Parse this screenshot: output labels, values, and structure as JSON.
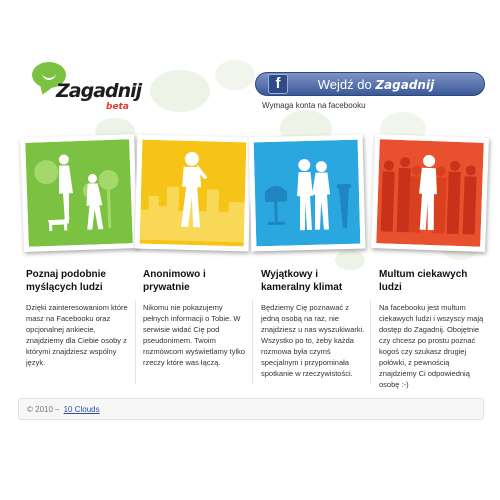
{
  "header": {
    "logo_text": "Zagadnij",
    "logo_badge": "beta",
    "facebook_button": {
      "icon": "facebook-f-icon",
      "label": "Wejdź do",
      "brand": "Zagadnij"
    },
    "facebook_note": "Wymaga konta na facebooku"
  },
  "tiles": [
    {
      "theme": "park-people-dog-icon",
      "color": "#7cc242"
    },
    {
      "theme": "city-silhouette-woman-icon",
      "color": "#f6c416"
    },
    {
      "theme": "lounge-chairs-couple-icon",
      "color": "#2aa7df"
    },
    {
      "theme": "crowd-silhouettes-icon",
      "color": "#e8502e"
    }
  ],
  "features": [
    {
      "title": "Poznaj podobnie myślących ludzi",
      "text": "Dzięki zainteresowaniom które masz na Facebooku oraz opcjonalnej ankiecie, znajdziemy dla Ciebie osoby z którymi znajdziesz wspólny język."
    },
    {
      "title": "Anonimowo i prywatnie",
      "text": "Nikomu nie pokazujemy pełnych informacji o Tobie. W serwisie widać Cię pod pseudonimem. Twoim rozmówcom wyświetlamy tylko rzeczy które was łączą."
    },
    {
      "title": "Wyjątkowy i kameralny klimat",
      "text": "Będziemy Cię poznawać z jedną osobą na raz, nie znajdziesz u nas wyszukiwarki. Wszystko po to, żeby każda rozmowa była czymś specjalnym i przypominała spotkanie w rzeczywistości."
    },
    {
      "title": "Multum ciekawych ludzi",
      "text": "Na facebooku jest multum ciekawych ludzi i wszyscy mają dostęp do Zagadnij. Obojętnie czy chcesz po prostu poznać kogoś czy szukasz drugiej połówki, z pewnością znajdziemy Ci odpowiednią osobę :-)"
    }
  ],
  "footer": {
    "copyright": "© 2010 –",
    "link": "10 Clouds"
  }
}
